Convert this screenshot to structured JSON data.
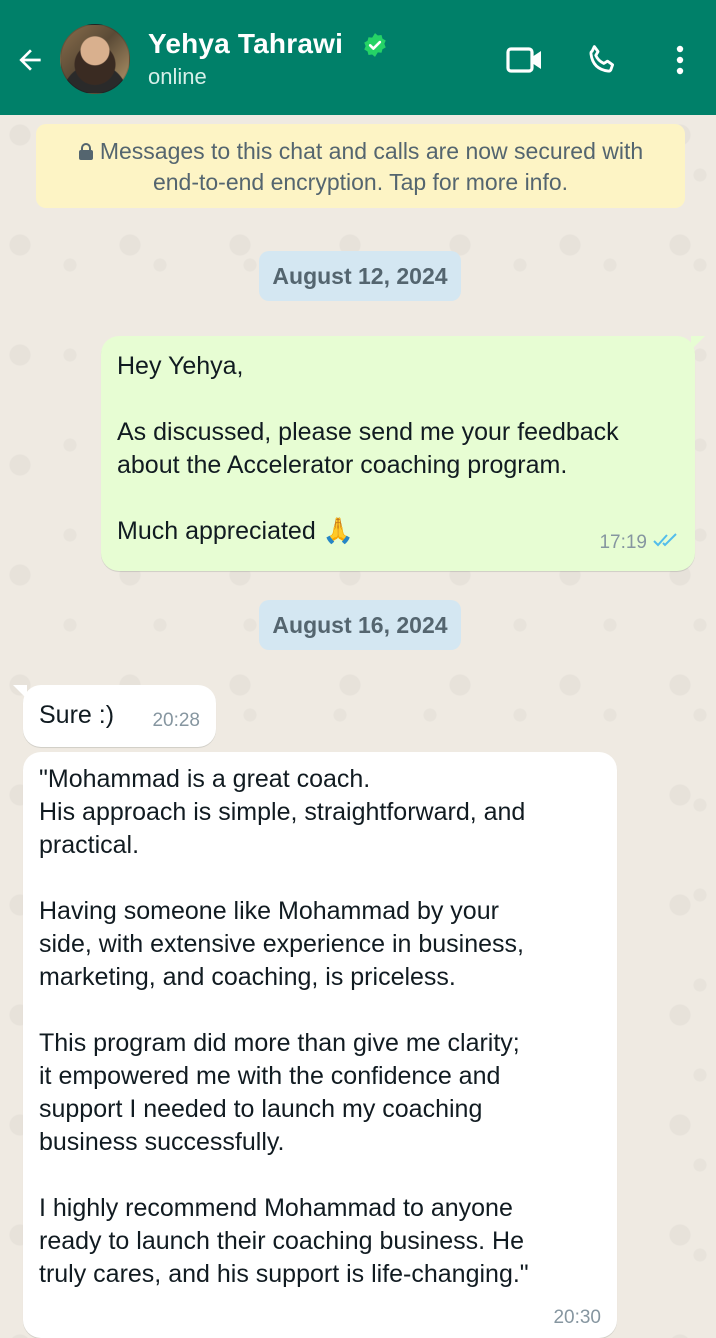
{
  "header": {
    "contact_name": "Yehya Tahrawi",
    "status": "online",
    "icons": [
      "back-arrow-icon",
      "verified-badge-icon",
      "video-call-icon",
      "voice-call-icon",
      "more-options-icon"
    ]
  },
  "encryption_notice": {
    "line1": "Messages to this chat and calls are now secured with",
    "line2": "end-to-end encryption. Tap for more info.",
    "icon": "lock-icon"
  },
  "messages_day1": {
    "date": "August 12, 2024",
    "outgoing": {
      "text": "Hey Yehya,\n\nAs discussed, please send me your feedback\nabout the Accelerator coaching program.\n\nMuch appreciated 🙏",
      "time": "17:19",
      "status_icon": "double-check-read-icon"
    }
  },
  "messages_day2": {
    "date": "August 16, 2024",
    "incoming_short": {
      "text": "Sure :)",
      "time": "20:28"
    },
    "incoming_long": {
      "text": "\"Mohammad is a great coach.\nHis approach is simple, straightforward, and\npractical.\n\nHaving someone like Mohammad by your\nside, with extensive experience in business,\nmarketing, and coaching, is priceless.\n\nThis program did more than give me clarity;\nit empowered me with the confidence and\nsupport I needed to launch my coaching\nbusiness successfully.\n\nI highly recommend Mohammad to anyone\nready to launch their coaching business. He\ntruly cares, and his support is life-changing.\"",
      "time": "20:30"
    }
  },
  "colors": {
    "header": "#008069",
    "chat_background": "#efeae2",
    "outgoing_bubble": "#e7fdd3",
    "incoming_bubble": "#ffffff",
    "date_chip": "#d4e7f2",
    "encryption_notice": "#fdf4c5",
    "read_ticks": "#53bdeb"
  }
}
